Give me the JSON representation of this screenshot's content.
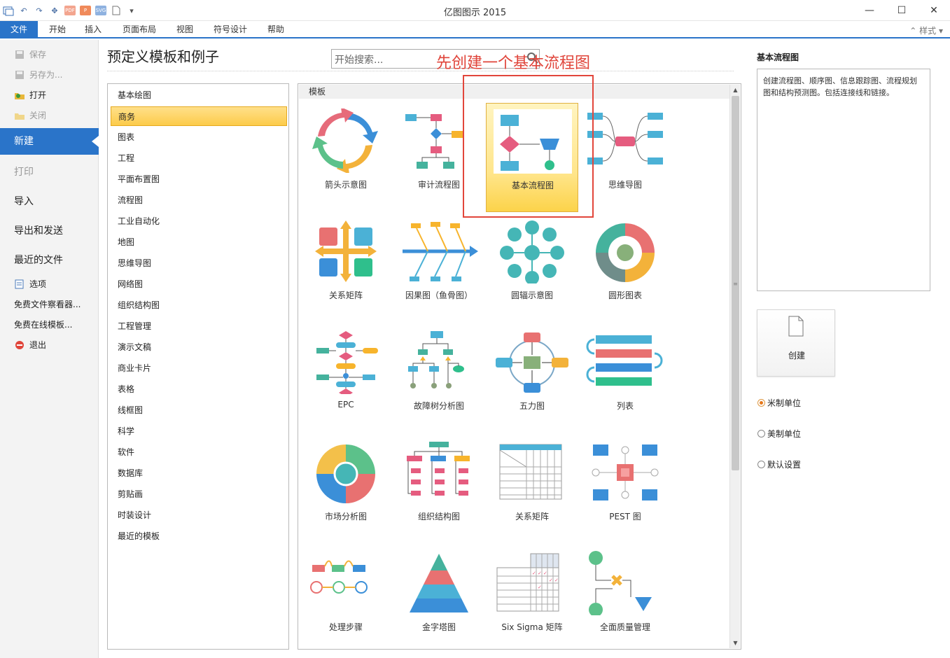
{
  "window": {
    "title": "亿图图示 2015",
    "minimize": "—",
    "maximize": "☐",
    "close": "✕"
  },
  "ribbon": {
    "tabs": [
      "文件",
      "开始",
      "插入",
      "页面布局",
      "视图",
      "符号设计",
      "帮助"
    ],
    "style_label": "样式"
  },
  "sidebar": {
    "save": "保存",
    "save_as": "另存为...",
    "open": "打开",
    "close": "关闭",
    "new": "新建",
    "print": "打印",
    "import": "导入",
    "export": "导出和发送",
    "recent": "最近的文件",
    "options": "选项",
    "viewer": "免费文件察看器...",
    "online": "免费在线模板...",
    "exit": "退出"
  },
  "main": {
    "heading": "预定义模板和例子",
    "search_placeholder": "开始搜索...",
    "annotation": "先创建一个基本流程图",
    "templates_header": "模板"
  },
  "categories": [
    "基本绘图",
    "商务",
    "图表",
    "工程",
    "平面布置图",
    "流程图",
    "工业自动化",
    "地图",
    "思维导图",
    "网络图",
    "组织结构图",
    "工程管理",
    "演示文稿",
    "商业卡片",
    "表格",
    "线框图",
    "科学",
    "软件",
    "数据库",
    "剪贴画",
    "时装设计",
    "最近的模板"
  ],
  "selected_category": "商务",
  "templates": [
    {
      "label": "箭头示意图",
      "icon": "arrow-cycle-icon"
    },
    {
      "label": "审计流程图",
      "icon": "audit-flow-icon"
    },
    {
      "label": "基本流程图",
      "icon": "basic-flowchart-icon",
      "selected": true
    },
    {
      "label": "思维导图",
      "icon": "mindmap-icon"
    },
    {
      "label": "关系矩阵",
      "icon": "cross-matrix-icon"
    },
    {
      "label": "因果图（鱼骨图）",
      "icon": "fishbone-icon"
    },
    {
      "label": "圆辐示意图",
      "icon": "spoke-icon"
    },
    {
      "label": "圆形图表",
      "icon": "ring-chart-icon"
    },
    {
      "label": "EPC",
      "icon": "epc-icon"
    },
    {
      "label": "故障树分析图",
      "icon": "fault-tree-icon"
    },
    {
      "label": "五力图",
      "icon": "five-forces-icon"
    },
    {
      "label": "列表",
      "icon": "list-icon"
    },
    {
      "label": "市场分析图",
      "icon": "market-pie-icon"
    },
    {
      "label": "组织结构图",
      "icon": "org-chart-icon"
    },
    {
      "label": "关系矩阵",
      "icon": "relation-table-icon"
    },
    {
      "label": "PEST 图",
      "icon": "pest-icon"
    },
    {
      "label": "处理步骤",
      "icon": "process-steps-icon"
    },
    {
      "label": "金字塔图",
      "icon": "pyramid-icon"
    },
    {
      "label": "Six Sigma 矩阵",
      "icon": "six-sigma-icon"
    },
    {
      "label": "全面质量管理",
      "icon": "tqm-icon"
    }
  ],
  "right": {
    "title": "基本流程图",
    "description": "创建流程图、顺序图、信息跟踪图、流程规划图和结构预测图。包括连接线和链接。",
    "create_label": "创建",
    "units": [
      {
        "label": "米制单位",
        "checked": true
      },
      {
        "label": "美制单位",
        "checked": false
      },
      {
        "label": "默认设置",
        "checked": false
      }
    ]
  },
  "colors": {
    "accent": "#2a74c9",
    "selection": "#fcd34a",
    "annotation": "#e2463b"
  }
}
